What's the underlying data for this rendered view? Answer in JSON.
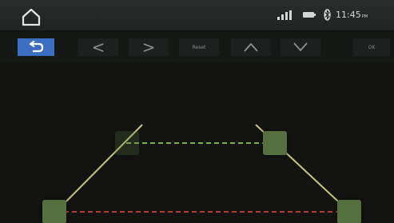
{
  "status_bar": {
    "time": "11:45",
    "ampm": "PM",
    "icons": [
      "home-icon",
      "signal-icon",
      "battery-icon",
      "bluetooth-icon"
    ]
  },
  "toolbar": {
    "back_icon": "back-arrow-icon",
    "prev_label": "<",
    "next_label": ">",
    "reset_label": "Reset",
    "up_icon": "chevron-up-icon",
    "down_icon": "chevron-down-icon",
    "ok_label": "OK"
  },
  "guide_lines": {
    "side_line_color": "#c9c57a",
    "near_line_color": "#b43a34",
    "far_line_color": "#7fb04a",
    "handle_color": "#54703f"
  }
}
